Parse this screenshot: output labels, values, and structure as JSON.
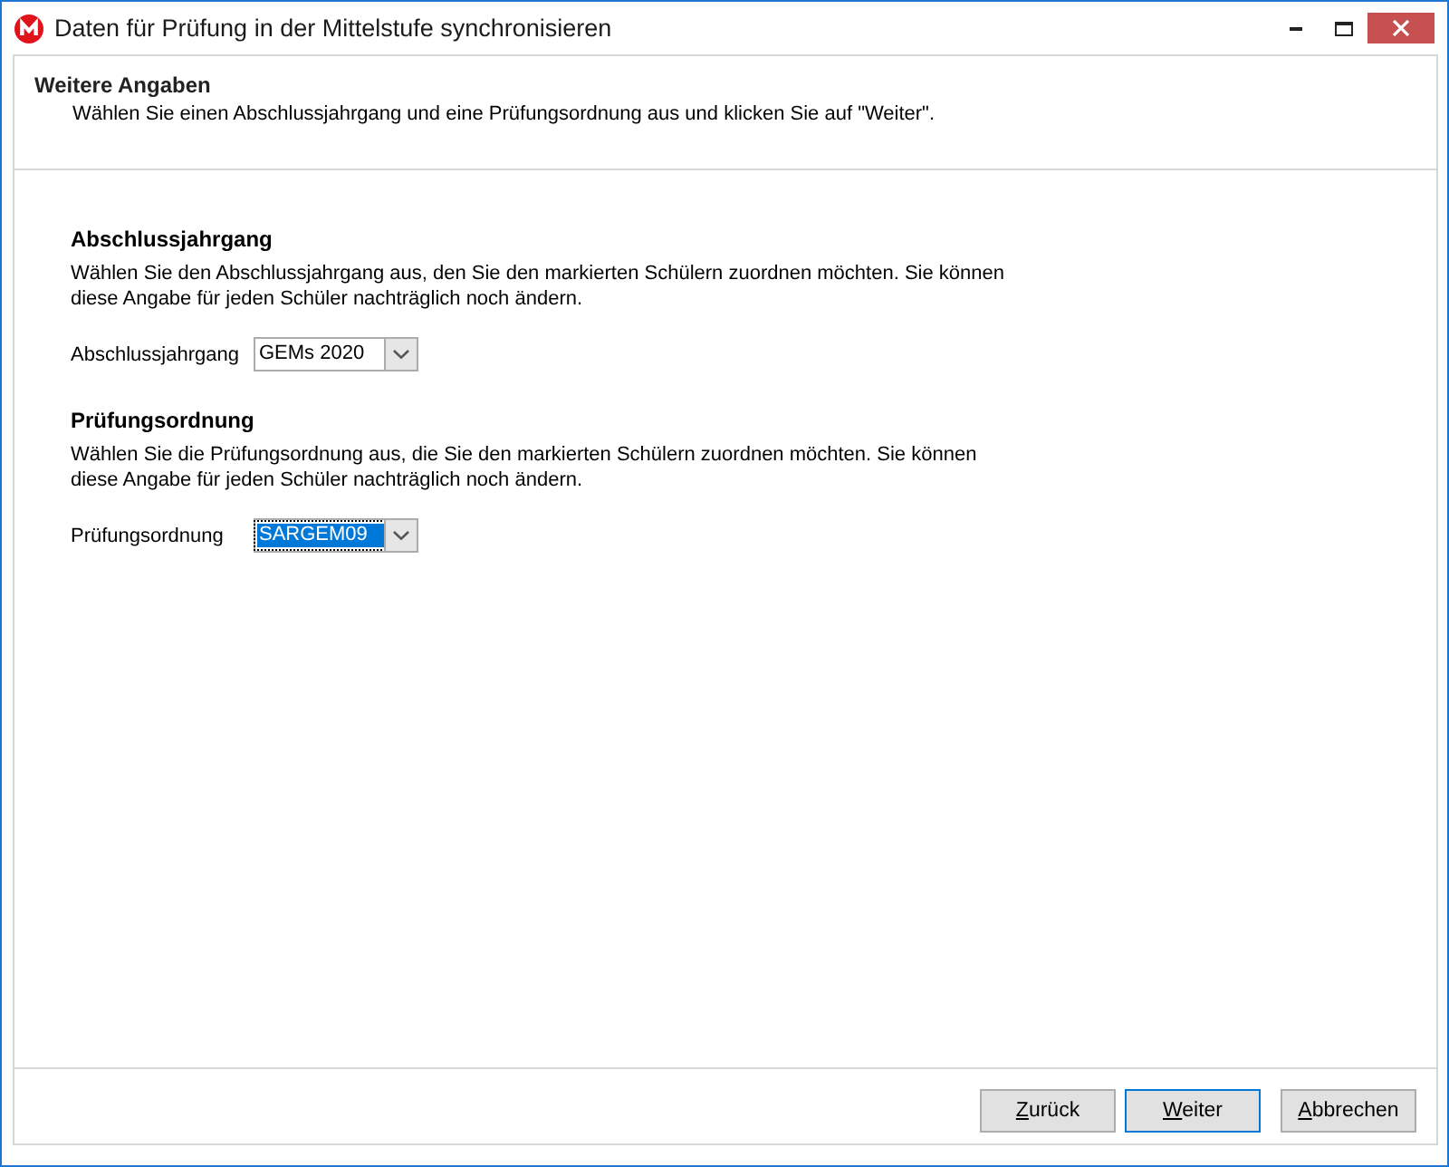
{
  "window": {
    "title": "Daten für Prüfung in der Mittelstufe synchronisieren"
  },
  "header": {
    "title": "Weitere Angaben",
    "description": "Wählen Sie einen Abschlussjahrgang und eine Prüfungsordnung aus und klicken Sie auf \"Weiter\"."
  },
  "sections": [
    {
      "heading": "Abschlussjahrgang",
      "description": "Wählen Sie den Abschlussjahrgang aus, den Sie den markierten Schülern zuordnen möchten. Sie können diese Angabe für jeden Schüler nachträglich noch ändern.",
      "field": {
        "label": "Abschlussjahrgang",
        "value": "GEMs 2020",
        "focused": false
      }
    },
    {
      "heading": "Prüfungsordnung",
      "description": "Wählen Sie die Prüfungsordnung aus, die Sie den markierten Schülern zuordnen möchten. Sie können diese Angabe für jeden Schüler nachträglich noch ändern.",
      "field": {
        "label": "Prüfungsordnung",
        "value": "SARGEM09",
        "focused": true
      }
    }
  ],
  "buttons": [
    {
      "label": "Zurück",
      "default": false,
      "mnemonic": true
    },
    {
      "label": "Weiter",
      "default": true,
      "mnemonic": true
    },
    {
      "label": "Abbrechen",
      "default": false,
      "mnemonic": true
    }
  ]
}
